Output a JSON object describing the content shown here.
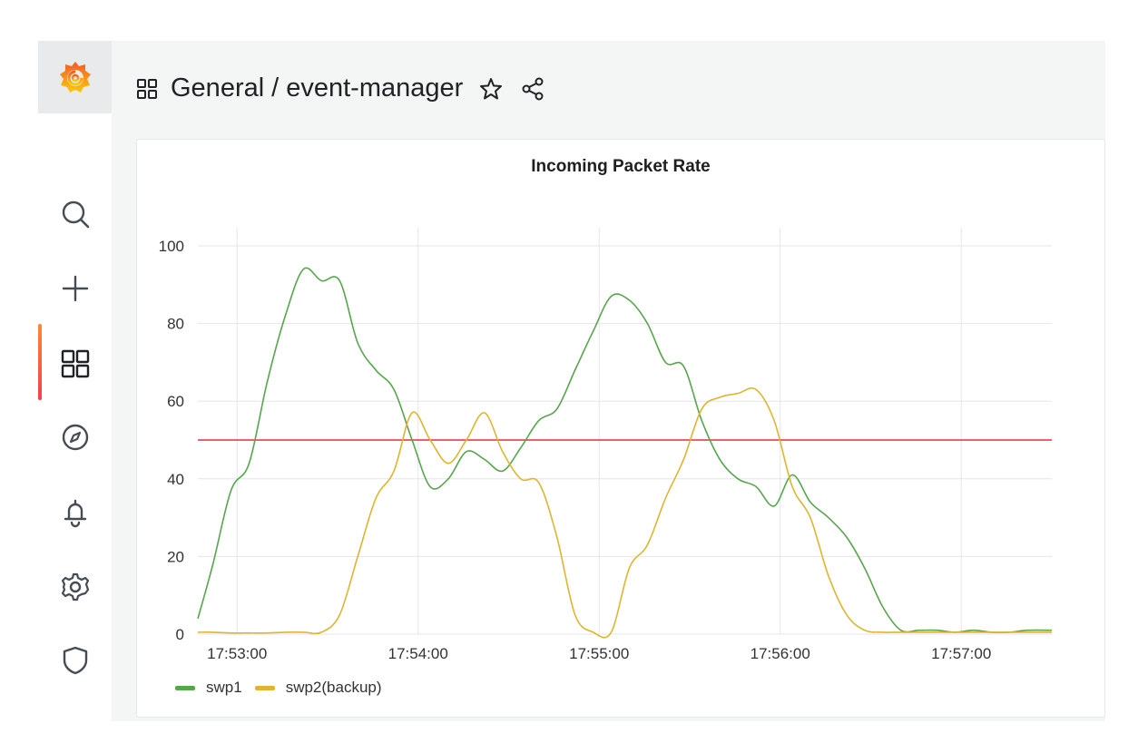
{
  "breadcrumb": {
    "folder": "General",
    "separator": "/",
    "dashboard": "event-manager"
  },
  "sidebar": {
    "items": [
      {
        "icon": "search-icon"
      },
      {
        "icon": "plus-icon"
      },
      {
        "icon": "dashboards-icon",
        "active": true
      },
      {
        "icon": "compass-icon"
      },
      {
        "icon": "bell-icon"
      },
      {
        "icon": "gear-icon"
      },
      {
        "icon": "shield-icon"
      }
    ]
  },
  "colors": {
    "swp1": "#56a64b",
    "swp2": "#e0b42e",
    "threshold": "#e02f44",
    "accent": "#f05a28"
  },
  "chart_data": {
    "type": "line",
    "title": "Incoming Packet Rate",
    "xlabel": "",
    "ylabel": "",
    "ylim": [
      0,
      100
    ],
    "yticks": [
      0,
      20,
      40,
      60,
      80,
      100
    ],
    "xticks": [
      "17:53:00",
      "17:54:00",
      "17:55:00",
      "17:56:00",
      "17:57:00"
    ],
    "xlim_seconds_from_1753": [
      -13,
      270
    ],
    "threshold": 50,
    "grid": true,
    "legend": "bottom-left",
    "x": [
      -13,
      -8,
      -2,
      4,
      10,
      16,
      22,
      28,
      34,
      40,
      46,
      52,
      58,
      64,
      70,
      76,
      82,
      88,
      94,
      100,
      106,
      112,
      118,
      124,
      130,
      136,
      142,
      148,
      154,
      160,
      166,
      172,
      178,
      184,
      190,
      196,
      202,
      208,
      214,
      220,
      226,
      232,
      238,
      244,
      250,
      256,
      262,
      270
    ],
    "series": [
      {
        "name": "swp1",
        "color": "#56a64b",
        "values": [
          4,
          18,
          37,
          44,
          65,
          82,
          94,
          91,
          91,
          75,
          68,
          63,
          50,
          38,
          40,
          47,
          45,
          42,
          48,
          55,
          58,
          68,
          78,
          87,
          86,
          80,
          70,
          69,
          55,
          45,
          40,
          38,
          33,
          41,
          34,
          30,
          25,
          17,
          7,
          1,
          1,
          1,
          0.5,
          1,
          0.5,
          0.5,
          1,
          1
        ]
      },
      {
        "name": "swp2(backup)",
        "color": "#e0b42e",
        "values": [
          0.5,
          0.5,
          0.3,
          0.3,
          0.3,
          0.5,
          0.5,
          0.5,
          5,
          20,
          35,
          42,
          57,
          50,
          44,
          50,
          57,
          47,
          40,
          39,
          25,
          5,
          0.5,
          0.5,
          17,
          23,
          35,
          45,
          58,
          61,
          62,
          63,
          55,
          38,
          30,
          15,
          5,
          1,
          0.5,
          0.5,
          0.5,
          0.5,
          0.5,
          0.5,
          0.5,
          0.5,
          0.5,
          0.5
        ]
      }
    ]
  }
}
